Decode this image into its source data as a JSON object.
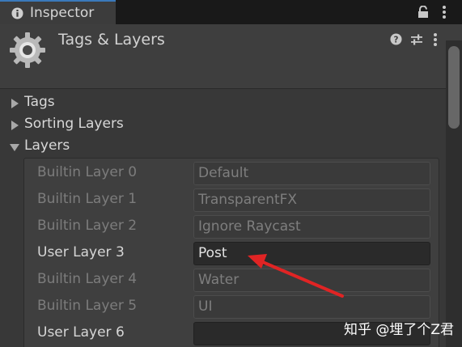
{
  "tab": {
    "label": "Inspector",
    "icon": "info-icon"
  },
  "header": {
    "title": "Tags & Layers",
    "icons": [
      "help-icon",
      "preset-icon",
      "kebab-menu-icon"
    ]
  },
  "foldouts": [
    {
      "label": "Tags",
      "expanded": false
    },
    {
      "label": "Sorting Layers",
      "expanded": false
    },
    {
      "label": "Layers",
      "expanded": true
    }
  ],
  "layers": [
    {
      "label": "Builtin Layer 0",
      "value": "Default",
      "editable": false
    },
    {
      "label": "Builtin Layer 1",
      "value": "TransparentFX",
      "editable": false
    },
    {
      "label": "Builtin Layer 2",
      "value": "Ignore Raycast",
      "editable": false
    },
    {
      "label": "User Layer 3",
      "value": "Post",
      "editable": true
    },
    {
      "label": "Builtin Layer 4",
      "value": "Water",
      "editable": false
    },
    {
      "label": "Builtin Layer 5",
      "value": "UI",
      "editable": false
    },
    {
      "label": "User Layer 6",
      "value": "",
      "editable": true
    }
  ],
  "annotation": {
    "arrow_color": "#e02424"
  },
  "watermark": "知乎 @埋了个Z君",
  "colors": {
    "accent": "#3a79bb",
    "background": "#383838"
  }
}
